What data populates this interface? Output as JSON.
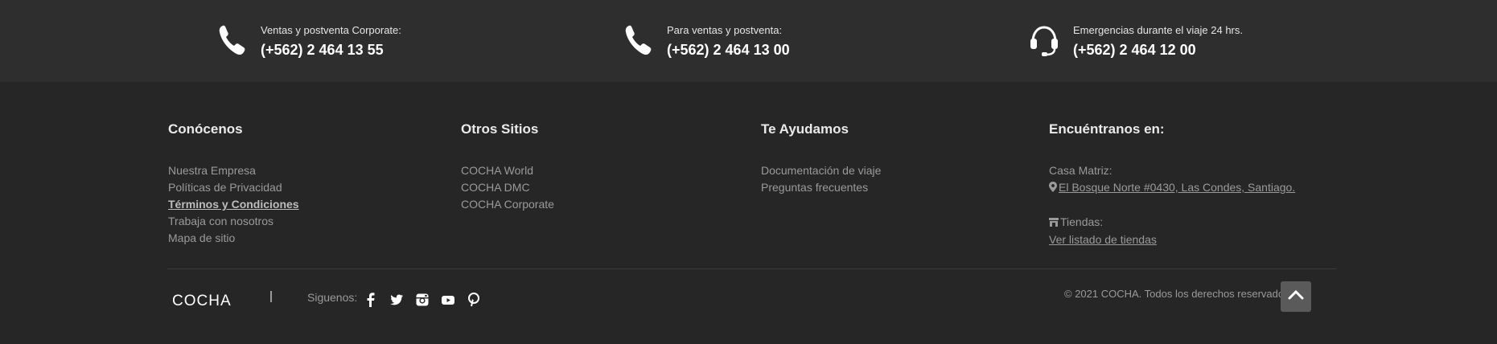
{
  "contacts": [
    {
      "icon": "phone-icon",
      "label": "Ventas y postventa Corporate:",
      "number": "(+562) 2 464 13 55"
    },
    {
      "icon": "phone-icon",
      "label": "Para ventas y postventa:",
      "number": "(+562) 2 464 13 00"
    },
    {
      "icon": "headset-icon",
      "label": "Emergencias durante el viaje 24 hrs.",
      "number": "(+562) 2 464 12 00"
    }
  ],
  "columns": {
    "conocenos": {
      "title": "Conócenos",
      "links": [
        "Nuestra Empresa",
        "Políticas de Privacidad",
        "Términos y Condiciones",
        "Trabaja con nosotros",
        "Mapa de sitio"
      ]
    },
    "otros": {
      "title": "Otros Sitios",
      "links": [
        "COCHA World",
        "COCHA DMC",
        "COCHA Corporate"
      ]
    },
    "ayudamos": {
      "title": "Te Ayudamos",
      "links": [
        "Documentación de viaje",
        "Preguntas frecuentes"
      ]
    },
    "encuentranos": {
      "title": "Encuéntranos en:",
      "casa_label": "Casa Matriz:",
      "address": "El Bosque Norte #0430, Las Condes, Santiago.",
      "tiendas_label": "Tiendas:",
      "tiendas_link": "Ver listado de tiendas"
    }
  },
  "footer": {
    "brand": "COCHA",
    "follow_label": "Siguenos:",
    "social": [
      "facebook-icon",
      "twitter-icon",
      "instagram-icon",
      "youtube-icon",
      "pinterest-icon"
    ],
    "copyright": "© 2021 COCHA. Todos los derechos reservados"
  },
  "colors": {
    "background": "#262626",
    "topbar": "#2e2e2e",
    "text": "#9a9a9a",
    "heading": "#eaeaea",
    "button": "#5a5a5a"
  }
}
